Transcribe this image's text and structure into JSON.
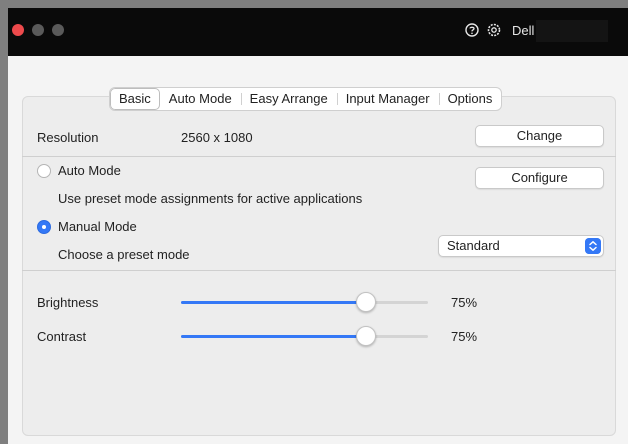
{
  "window": {
    "help_icon": "question-circle-icon",
    "settings_icon": "gear-icon",
    "account_label": "Dell"
  },
  "tabs": [
    {
      "label": "Basic",
      "active": true
    },
    {
      "label": "Auto Mode",
      "active": false
    },
    {
      "label": "Easy Arrange",
      "active": false
    },
    {
      "label": "Input Manager",
      "active": false
    },
    {
      "label": "Options",
      "active": false
    }
  ],
  "resolution": {
    "label": "Resolution",
    "value": "2560 x 1080",
    "button": "Change"
  },
  "modes": {
    "auto_label": "Auto Mode",
    "auto_selected": false,
    "auto_description": "Use preset mode assignments for active applications",
    "configure_button": "Configure",
    "manual_label": "Manual Mode",
    "manual_selected": true,
    "preset_label": "Choose a preset mode",
    "preset_value": "Standard"
  },
  "adjustments": {
    "brightness_label": "Brightness",
    "brightness_value": "75%",
    "brightness_level": 0.75,
    "contrast_label": "Contrast",
    "contrast_value": "75%",
    "contrast_level": 0.75
  },
  "colors": {
    "accent": "#3478f6",
    "close_button": "#ed4a4c"
  }
}
